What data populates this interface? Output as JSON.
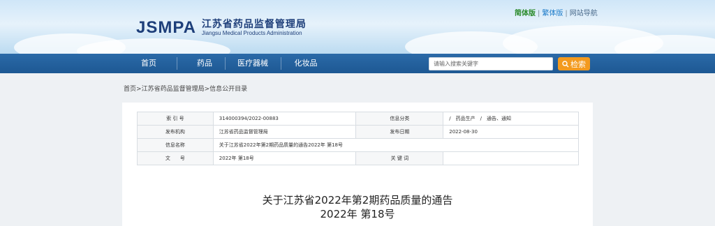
{
  "header": {
    "logo_mark": "JSMPA",
    "logo_cn": "江苏省药品监督管理局",
    "logo_en": "Jiangsu Medical Products Administration",
    "links": {
      "simplified": "简体版",
      "traditional": "繁体版",
      "site_nav": "网站导航",
      "separator": "|"
    }
  },
  "nav": {
    "items": [
      "首页",
      "药品",
      "医疗器械",
      "化妆品"
    ],
    "search_placeholder": "请输入搜索关键字",
    "search_button": "检索"
  },
  "breadcrumb": {
    "items": [
      "首页",
      "江苏省药品监督管理局",
      "信息公开目录"
    ],
    "separator": ">"
  },
  "meta_table": {
    "rows": [
      {
        "label1": "索 引 号",
        "value1": "314000394/2022-00883",
        "label2": "信息分类",
        "value2": "/　药品生产　/　通告、通知"
      },
      {
        "label1": "发布机构",
        "value1": "江苏省药品监督管理局",
        "label2": "发布日期",
        "value2": "2022-08-30"
      },
      {
        "label1": "信息名称",
        "value1": "关于江苏省2022年第2期药品质量的通告2022年 第18号",
        "label2": "",
        "value2": ""
      },
      {
        "label1": "文　　号",
        "value1": "2022年 第18号",
        "label2": "关 键 词",
        "value2": ""
      }
    ]
  },
  "document": {
    "title": "关于江苏省2022年第2期药品质量的通告",
    "number": "2022年 第18号"
  },
  "colors": {
    "nav_bg": "#1d5893",
    "search_button": "#f39a1e",
    "logo_blue": "#1e3f7a"
  }
}
